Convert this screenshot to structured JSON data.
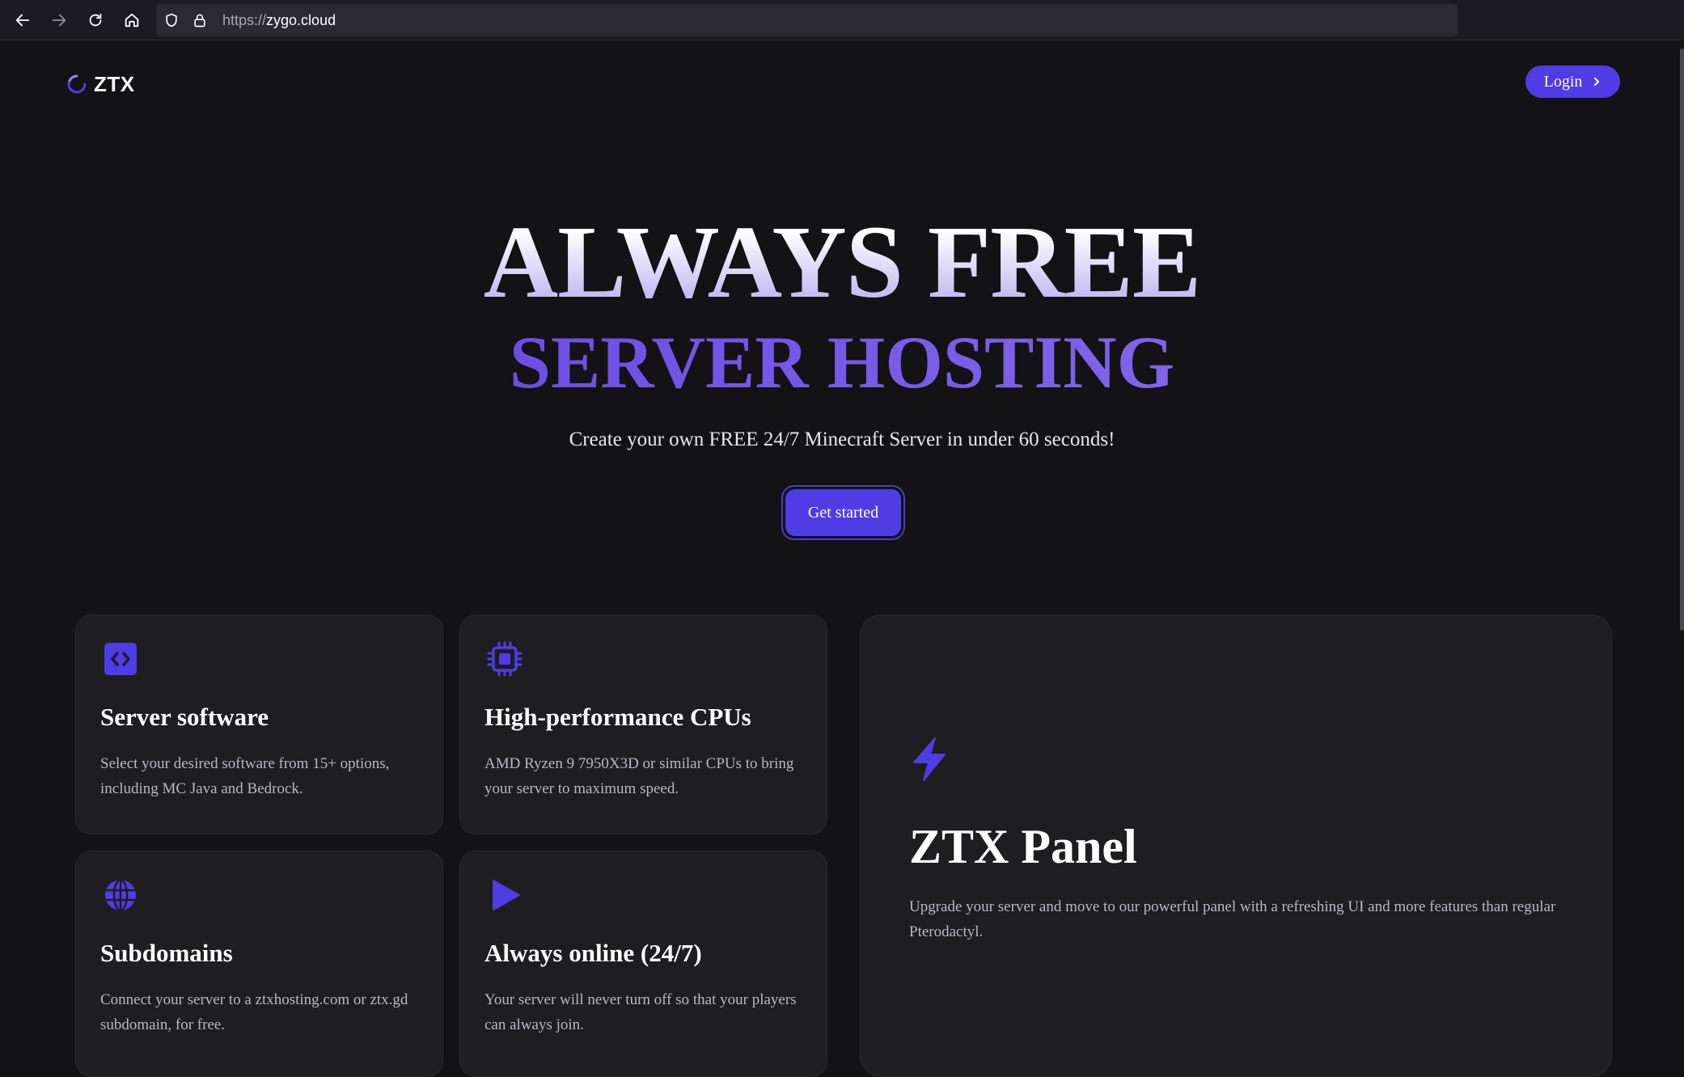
{
  "browser": {
    "url_scheme": "https://",
    "url_host": "zygo.cloud"
  },
  "header": {
    "logo_text": "ZTX",
    "login_label": "Login"
  },
  "hero": {
    "title_line1": "ALWAYS FREE",
    "title_line2": "SERVER HOSTING",
    "subtitle": "Create your own FREE 24/7 Minecraft Server in under 60 seconds!",
    "cta_label": "Get started"
  },
  "features": [
    {
      "icon": "code-icon",
      "title": "Server software",
      "description": "Select your desired software from 15+ options, including MC Java and Bedrock."
    },
    {
      "icon": "cpu-icon",
      "title": "High-performance CPUs",
      "description": "AMD Ryzen 9 7950X3D or similar CPUs to bring your server to maximum speed."
    },
    {
      "icon": "globe-icon",
      "title": "Subdomains",
      "description": "Connect your server to a ztxhosting.com or ztx.gd subdomain, for free."
    },
    {
      "icon": "play-icon",
      "title": "Always online (24/7)",
      "description": "Your server will never turn off so that your players can always join."
    }
  ],
  "panel_card": {
    "icon": "lightning-icon",
    "title": "ZTX Panel",
    "description": "Upgrade your server and move to our powerful panel with a refreshing UI and more features than regular Pterodactyl."
  },
  "colors": {
    "accent": "#4f3ce5",
    "background": "#131214",
    "card": "#1e1e20"
  }
}
